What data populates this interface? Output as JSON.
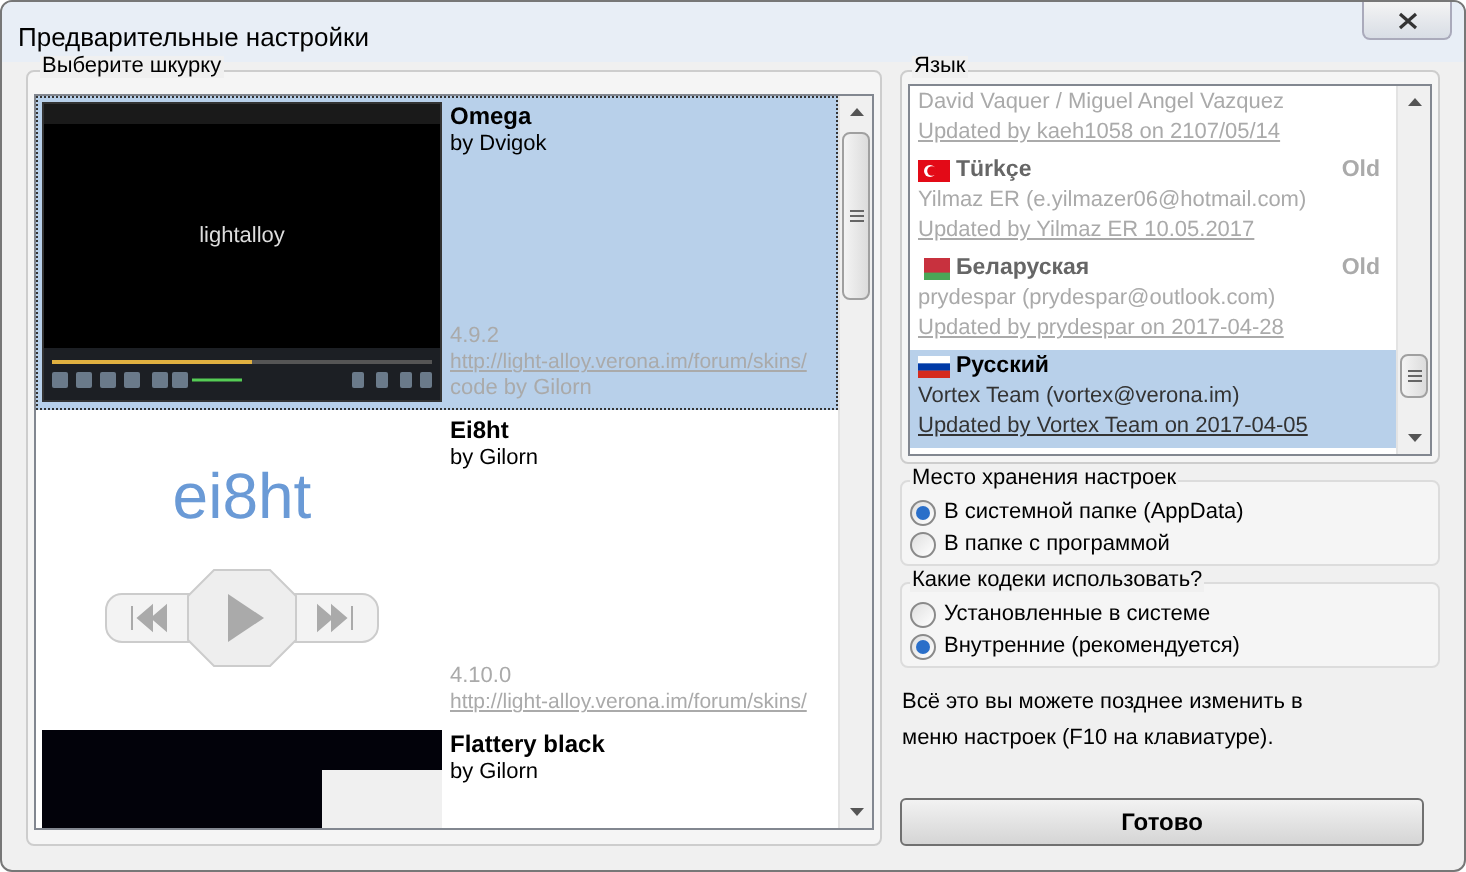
{
  "window": {
    "title": "Предварительные настройки"
  },
  "skin_group": {
    "title": "Выберите шкурку",
    "skins": [
      {
        "name": "Omega",
        "author": "by Dvigok",
        "version": "4.9.2",
        "url": "http://light-alloy.verona.im/forum/skins/",
        "credit": "code by Gilorn",
        "selected": true,
        "preview": {
          "kind": "dark-player",
          "text": "lightalloy"
        }
      },
      {
        "name": "Ei8ht",
        "author": "by Gilorn",
        "version": "4.10.0",
        "url": "http://light-alloy.verona.im/forum/skins/",
        "selected": false,
        "preview": {
          "kind": "light-player",
          "text": "ei8ht"
        }
      },
      {
        "name": "Flattery black",
        "author": "by Gilorn",
        "selected": false,
        "preview": {
          "kind": "black-window"
        }
      }
    ]
  },
  "language_group": {
    "title": "Язык",
    "languages": [
      {
        "kind": "plain",
        "author": "David Vaquer / Miguel Angel Vazquez",
        "updated": "Updated by kaeh1058 on 2107/05/14",
        "selected": false
      },
      {
        "kind": "turkey",
        "name": "Türkçe",
        "badge": "Old",
        "author": "Yilmaz ER (e.yilmazer06@hotmail.com)",
        "updated": "Updated by Yilmaz ER  10.05.2017",
        "selected": false
      },
      {
        "kind": "belarus",
        "name": "Беларуская",
        "badge": "Old",
        "author": "prydespar (prydespar@outlook.com)",
        "updated": "Updated by prydespar on 2017-04-28",
        "selected": false
      },
      {
        "kind": "russia",
        "name": "Русский",
        "author": "Vortex Team (vortex@verona.im)",
        "updated": "Updated by Vortex Team on 2017-04-05",
        "selected": true
      }
    ]
  },
  "radio_groups": [
    {
      "title": "Место хранения настроек",
      "options": [
        {
          "label": "В системной папке (AppData)",
          "selected": true
        },
        {
          "label": "В папке с программой",
          "selected": false
        }
      ]
    },
    {
      "title": "Какие кодеки использовать?",
      "options": [
        {
          "label": "Установленные в системе",
          "selected": false
        },
        {
          "label": "Внутренние (рекомендуется)",
          "selected": true
        }
      ]
    }
  ],
  "note": "Всё это вы можете позднее изменить в меню настроек (F10 на клавиатуре).",
  "done_button": "Готово"
}
